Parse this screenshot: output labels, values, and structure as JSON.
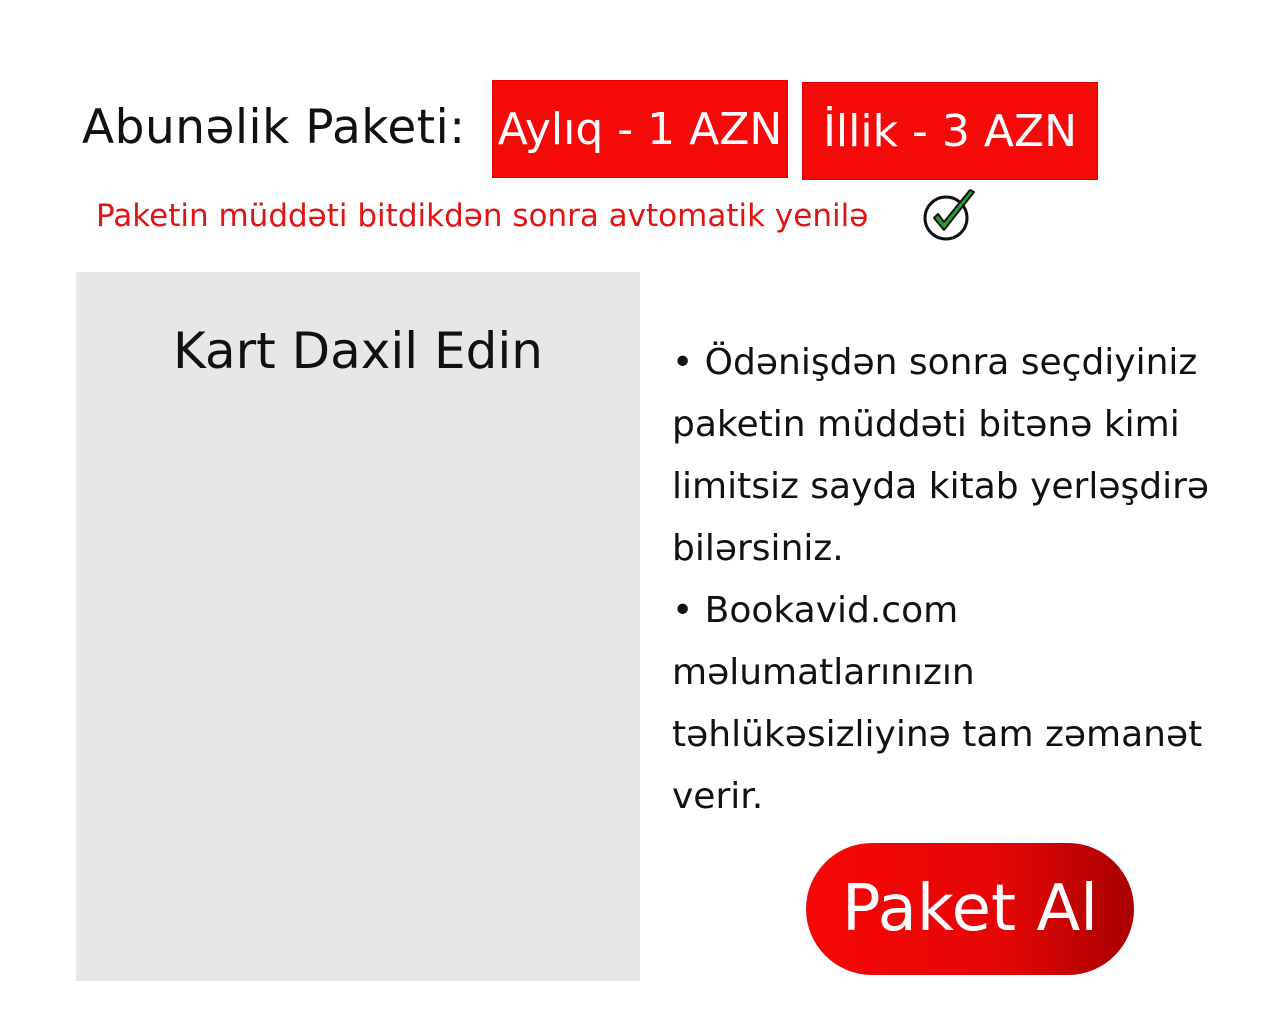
{
  "subscription": {
    "label": "Abunəlik Paketi:",
    "plans": [
      {
        "label": "Aylıq - 1 AZN"
      },
      {
        "label": "İllik - 3 AZN"
      }
    ],
    "auto_renew_text": "Paketin müddəti bitdikdən sonra avtomatik yenilə",
    "auto_renew_checked": true
  },
  "card": {
    "title": "Kart Daxil Edin"
  },
  "info": {
    "bullet1": "• Ödənişdən sonra seçdiyiniz paketin müddəti bitənə kimi limitsiz sayda kitab yerləşdirə bilərsiniz.",
    "bullet2": "• Bookavid.com məlumatlarınızın təhlükəsizliyinə tam zəmanət verir."
  },
  "buy_button": {
    "label": "Paket Al"
  },
  "colors": {
    "accent": "#f50a0a",
    "panel": "#e6e7e9",
    "check": "#1fa62a"
  },
  "icons": {
    "auto_renew": "checkmark-circle-icon"
  }
}
